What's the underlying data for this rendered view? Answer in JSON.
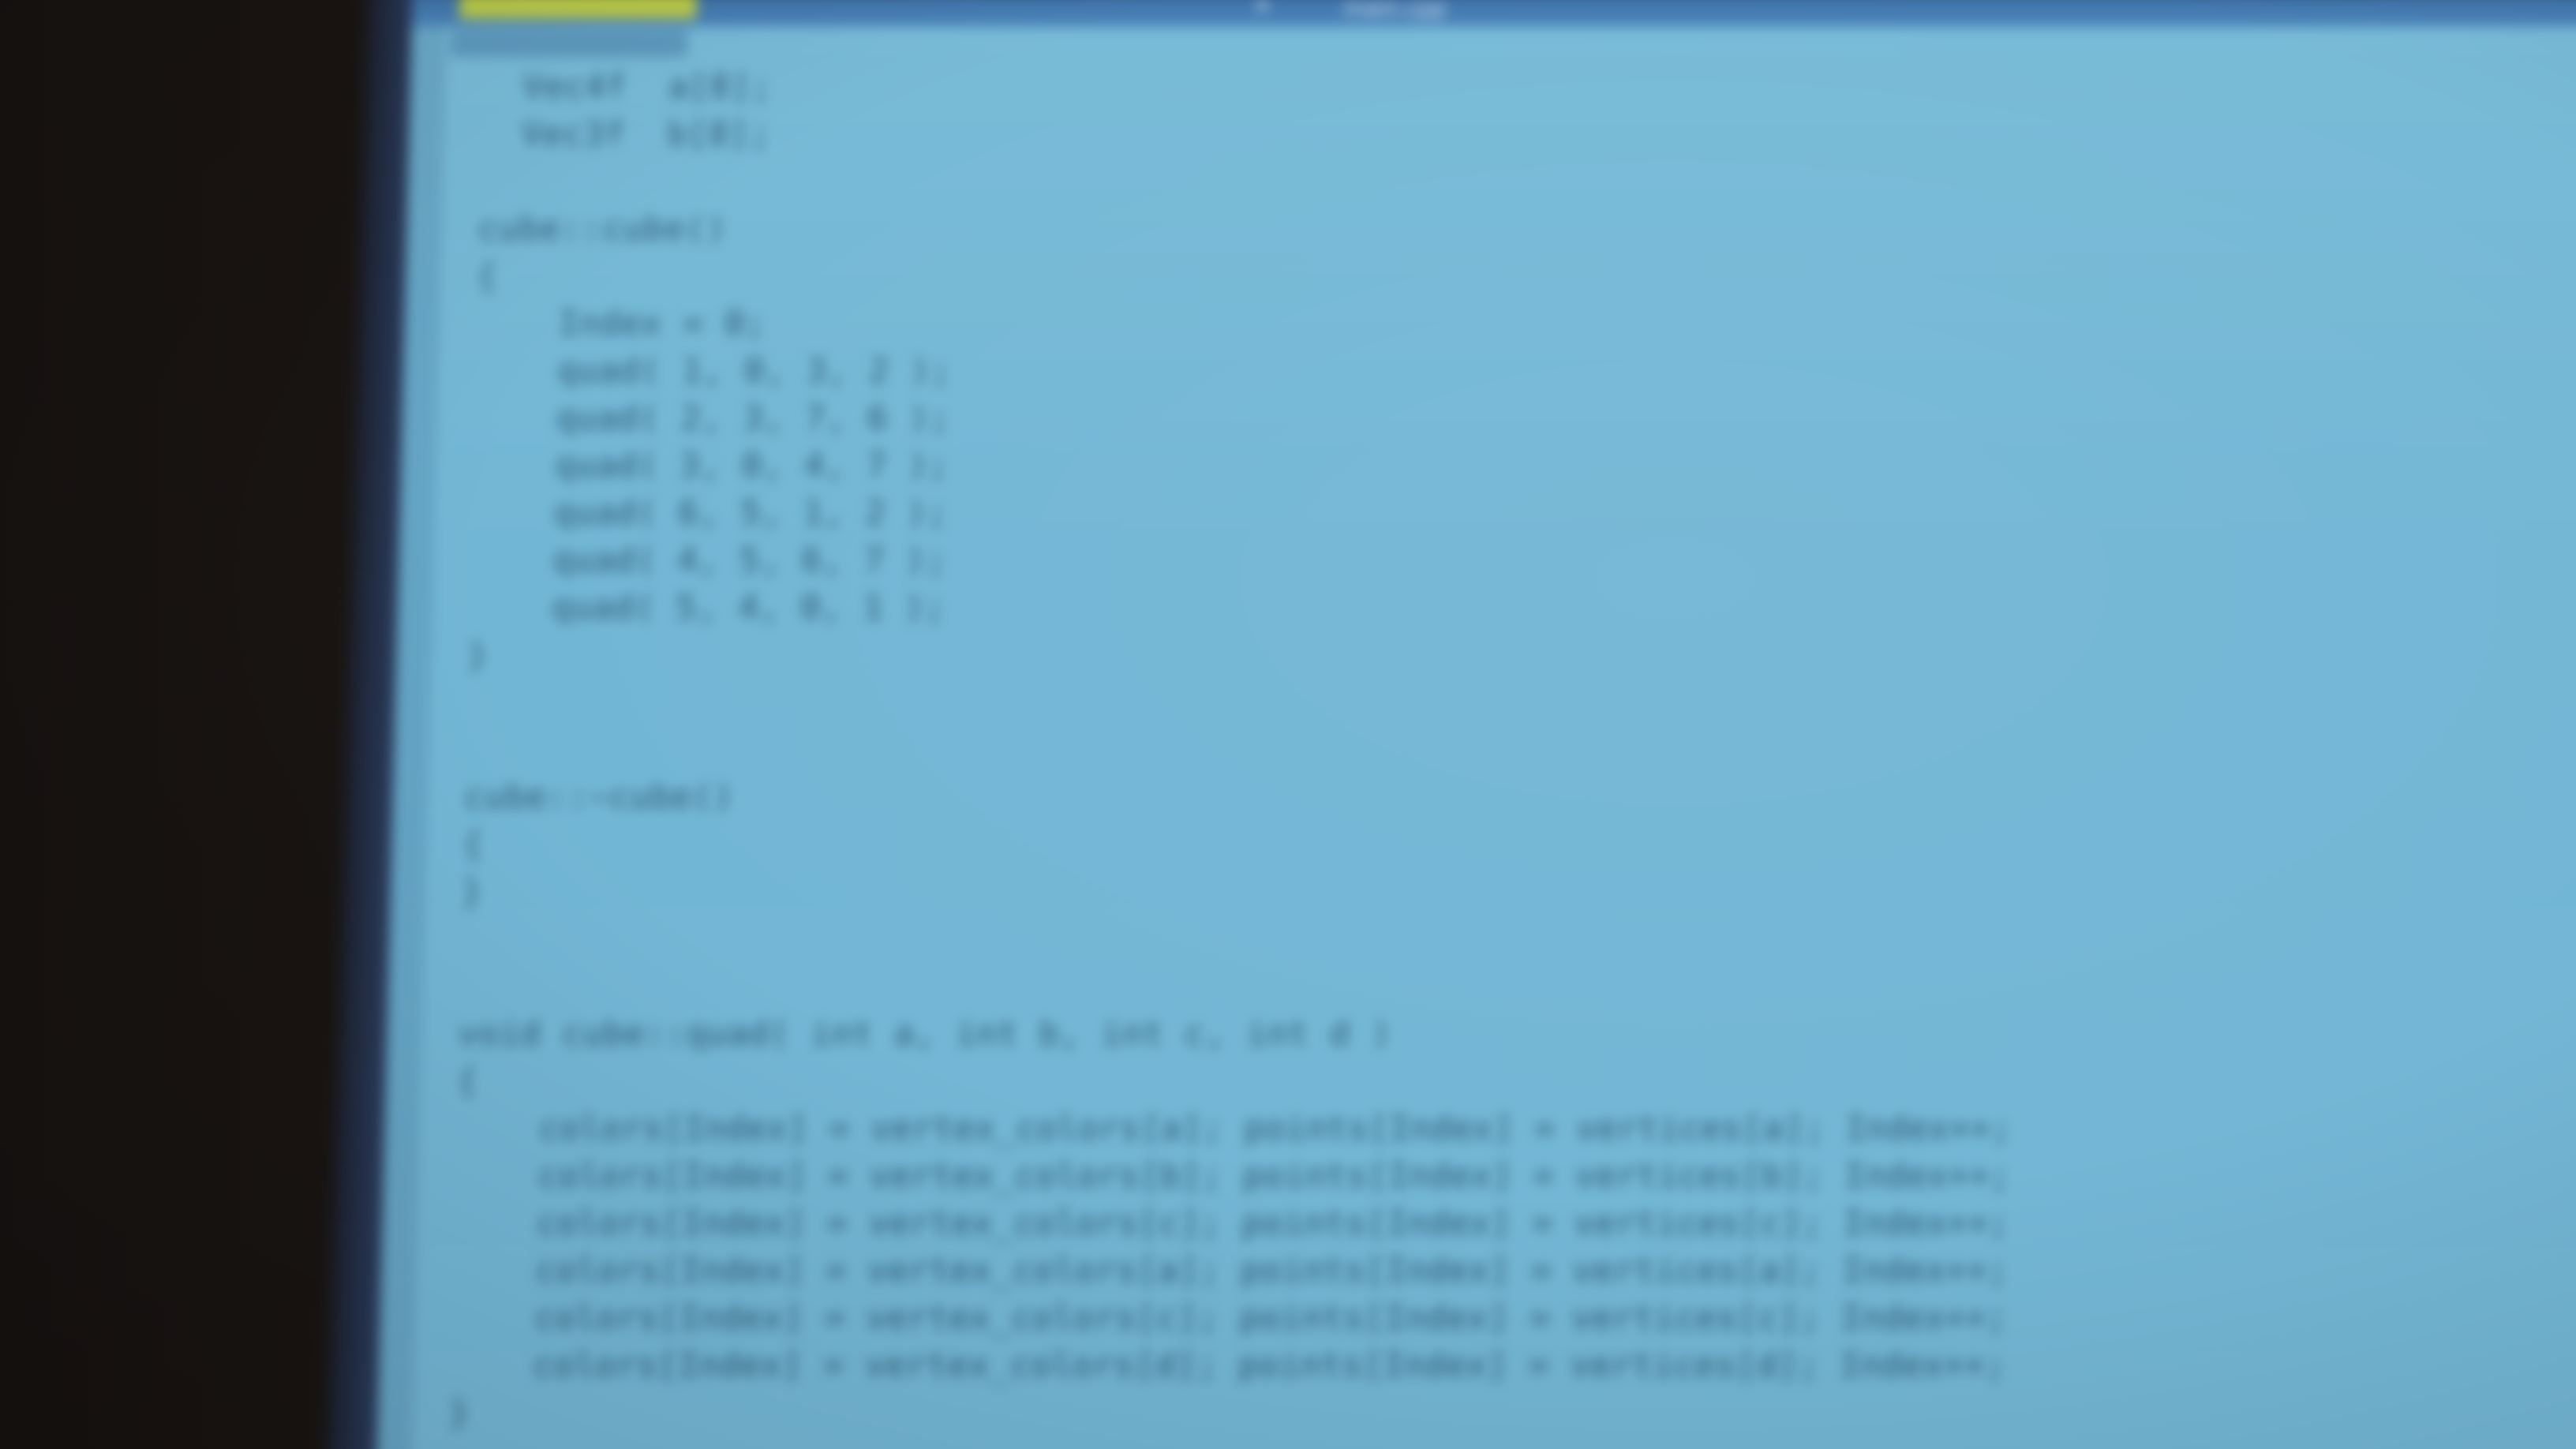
{
  "editor": {
    "tab_label": "main.cpp",
    "tab_arrow": "▾",
    "accent_tab_color": "#b8c84a",
    "code_lines": [
      "  Vec4f  a[8];",
      "  Vec3f  b[8];",
      "",
      "cube::cube()",
      "{",
      "    Index = 0;",
      "    quad( 1, 0, 3, 2 );",
      "    quad( 2, 3, 7, 6 );",
      "    quad( 3, 0, 4, 7 );",
      "    quad( 6, 5, 1, 2 );",
      "    quad( 4, 5, 6, 7 );",
      "    quad( 5, 4, 0, 1 );",
      "}",
      "",
      "",
      "cube::~cube()",
      "{",
      "}",
      "",
      "",
      "void cube::quad( int a, int b, int c, int d )",
      "{",
      "    colors[Index] = vertex_colors[a]; points[Index] = vertices[a]; Index++;",
      "    colors[Index] = vertex_colors[b]; points[Index] = vertices[b]; Index++;",
      "    colors[Index] = vertex_colors[c]; points[Index] = vertices[c]; Index++;",
      "    colors[Index] = vertex_colors[a]; points[Index] = vertices[a]; Index++;",
      "    colors[Index] = vertex_colors[c]; points[Index] = vertices[c]; Index++;",
      "    colors[Index] = vertex_colors[d]; points[Index] = vertices[d]; Index++;",
      "}"
    ]
  }
}
